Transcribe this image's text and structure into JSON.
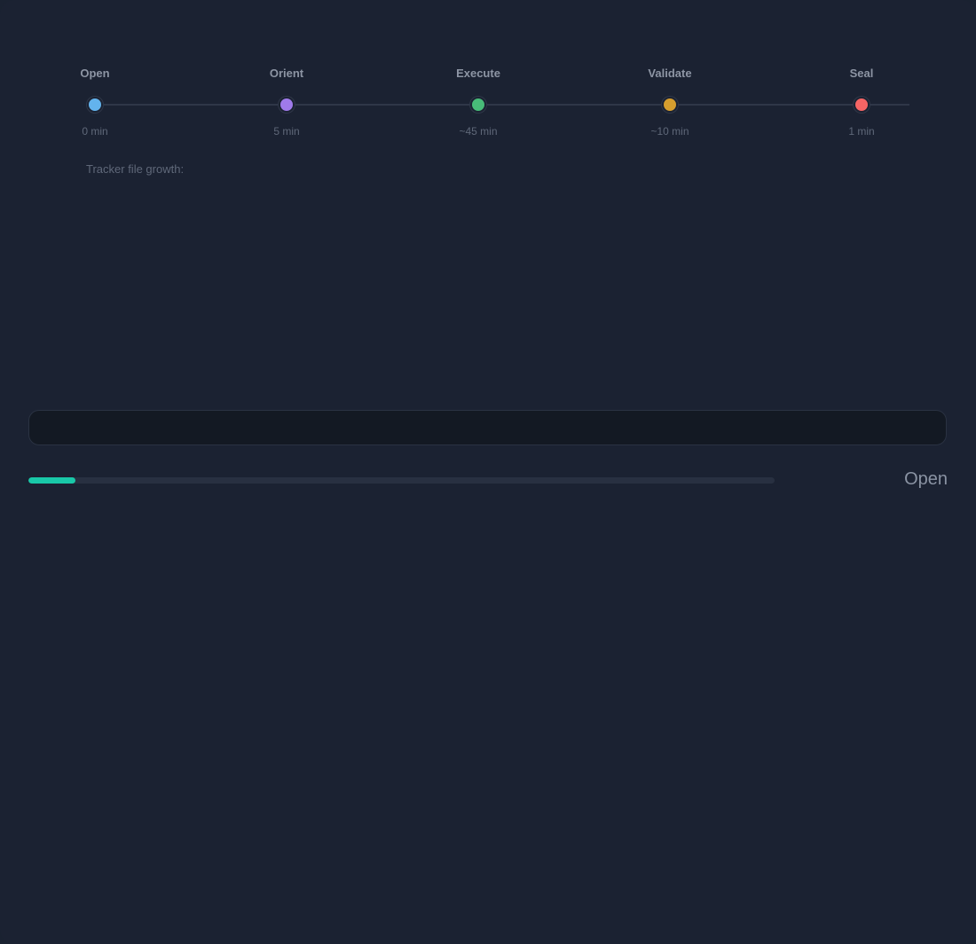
{
  "timeline": {
    "stages": [
      {
        "name": "Open",
        "time": "0 min",
        "color": "#63b3ed"
      },
      {
        "name": "Orient",
        "time": "5 min",
        "color": "#9f7aea"
      },
      {
        "name": "Execute",
        "time": "~45 min",
        "color": "#48bb78"
      },
      {
        "name": "Validate",
        "time": "~10 min",
        "color": "#d69e2e"
      },
      {
        "name": "Seal",
        "time": "1 min",
        "color": "#f56565"
      }
    ]
  },
  "growth": {
    "label": "Tracker file growth:"
  },
  "input": {
    "value": ""
  },
  "progress": {
    "fraction": 0.063,
    "color": "#19c8a8",
    "phase_label": "Open"
  }
}
